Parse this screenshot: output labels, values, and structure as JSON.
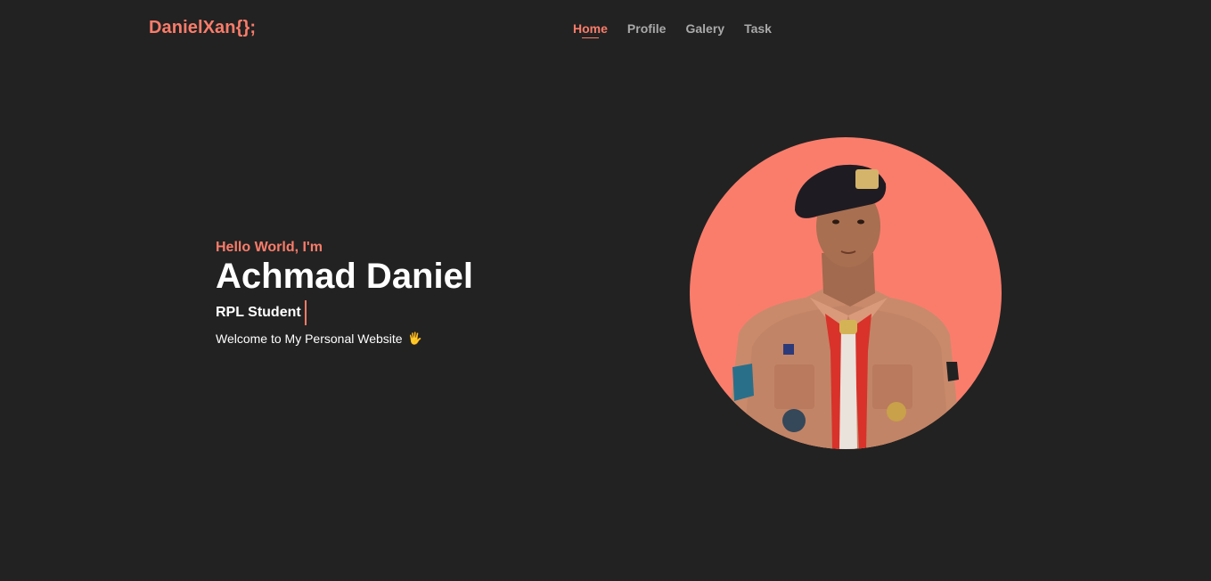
{
  "brand": "DanielXan{};",
  "nav": {
    "items": [
      {
        "label": "Home",
        "active": true
      },
      {
        "label": "Profile",
        "active": false
      },
      {
        "label": "Galery",
        "active": false
      },
      {
        "label": "Task",
        "active": false
      }
    ]
  },
  "hero": {
    "greeting": "Hello World, I'm",
    "name": "Achmad Daniel",
    "role": "RPL Student",
    "welcome": "Welcome to My Personal Website",
    "welcome_emoji": "🖐"
  },
  "colors": {
    "background": "#222222",
    "accent": "#fa7c6a",
    "nav_inactive": "#a9a9a9"
  }
}
